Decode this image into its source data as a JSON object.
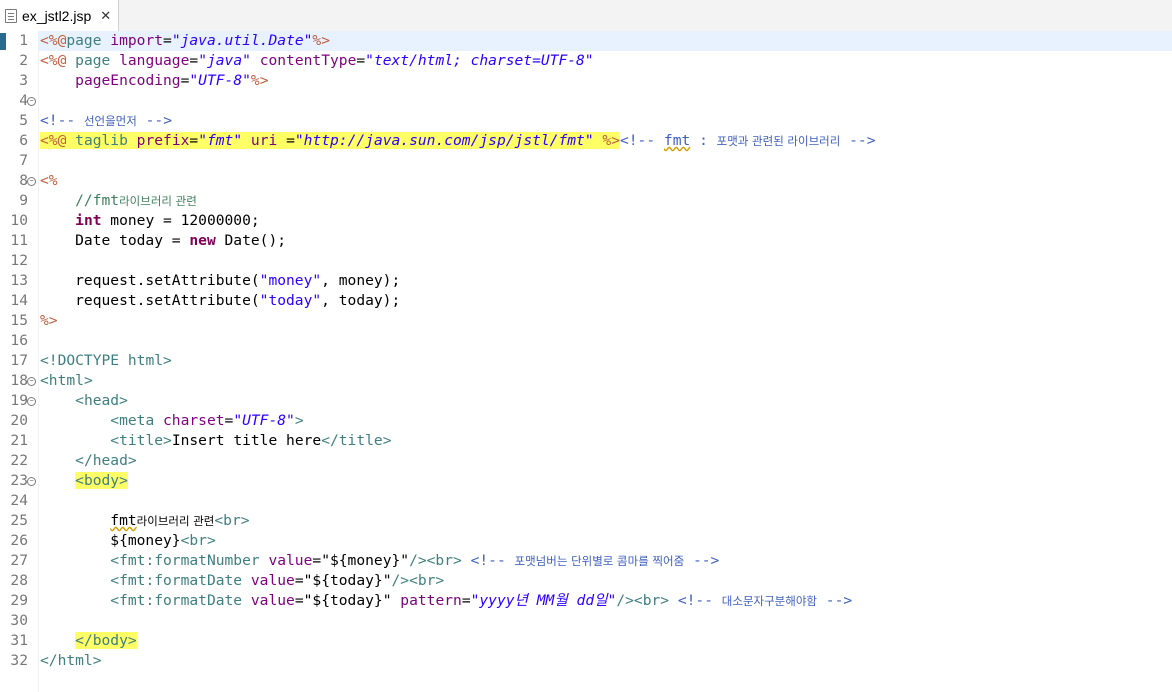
{
  "tab": {
    "title": "ex_jstl2.jsp",
    "close": "✕"
  },
  "lines": [
    {
      "n": "1",
      "cur": true,
      "segs": [
        {
          "t": "<%@",
          "c": "c-dir"
        },
        {
          "t": "page ",
          "c": "c-kw"
        },
        {
          "t": "import",
          "c": "c-attr"
        },
        {
          "t": "=",
          "c": ""
        },
        {
          "t": "\"java.util.Date\"",
          "c": "c-str"
        },
        {
          "t": "%>",
          "c": "c-dir"
        }
      ]
    },
    {
      "n": "2",
      "segs": [
        {
          "t": "<%@ ",
          "c": "c-dir"
        },
        {
          "t": "page ",
          "c": "c-kw"
        },
        {
          "t": "language",
          "c": "c-attr"
        },
        {
          "t": "=",
          "c": ""
        },
        {
          "t": "\"java\"",
          "c": "c-str"
        },
        {
          "t": " ",
          "c": ""
        },
        {
          "t": "contentType",
          "c": "c-attr"
        },
        {
          "t": "=",
          "c": ""
        },
        {
          "t": "\"text/html; charset=UTF-8\"",
          "c": "c-str"
        }
      ]
    },
    {
      "n": "3",
      "segs": [
        {
          "t": "    ",
          "c": ""
        },
        {
          "t": "pageEncoding",
          "c": "c-attr"
        },
        {
          "t": "=",
          "c": ""
        },
        {
          "t": "\"UTF-8\"",
          "c": "c-str"
        },
        {
          "t": "%>",
          "c": "c-dir"
        }
      ]
    },
    {
      "n": "4",
      "fold": true,
      "segs": []
    },
    {
      "n": "5",
      "segs": [
        {
          "t": "<!-- ",
          "c": "c-cm"
        },
        {
          "t": "선언을먼저",
          "c": "c-cm kr"
        },
        {
          "t": " -->",
          "c": "c-cm"
        }
      ]
    },
    {
      "n": "6",
      "segs": [
        {
          "t": "<%@ ",
          "c": "c-dir hl"
        },
        {
          "t": "taglib ",
          "c": "c-kw hl"
        },
        {
          "t": "prefix",
          "c": "c-attr hl"
        },
        {
          "t": "=",
          "c": "hl"
        },
        {
          "t": "\"fmt\"",
          "c": "c-str hl"
        },
        {
          "t": " ",
          "c": "hl"
        },
        {
          "t": "uri ",
          "c": "c-attr hl"
        },
        {
          "t": "=",
          "c": "hl"
        },
        {
          "t": "\"http://java.sun.com/jsp/jstl/fmt\"",
          "c": "c-str hl"
        },
        {
          "t": " ",
          "c": "hl"
        },
        {
          "t": "%>",
          "c": "c-dir hl"
        },
        {
          "t": "<!-- ",
          "c": "c-cm"
        },
        {
          "t": "fmt",
          "c": "c-cm squig"
        },
        {
          "t": " : ",
          "c": "c-cm"
        },
        {
          "t": "포맷과 관련된 라이브러리",
          "c": "c-cm kr"
        },
        {
          "t": " -->",
          "c": "c-cm"
        }
      ]
    },
    {
      "n": "7",
      "segs": []
    },
    {
      "n": "8",
      "fold": true,
      "segs": [
        {
          "t": "<%",
          "c": "c-dir"
        }
      ]
    },
    {
      "n": "9",
      "segs": [
        {
          "t": "    //fmt",
          "c": "c-jcm"
        },
        {
          "t": "라이브러리 관련",
          "c": "c-jcm kr"
        }
      ]
    },
    {
      "n": "10",
      "segs": [
        {
          "t": "    ",
          "c": ""
        },
        {
          "t": "int",
          "c": "c-jkw"
        },
        {
          "t": " money = 12000000;",
          "c": ""
        }
      ]
    },
    {
      "n": "11",
      "segs": [
        {
          "t": "    Date today = ",
          "c": ""
        },
        {
          "t": "new",
          "c": "c-jkw"
        },
        {
          "t": " Date();",
          "c": ""
        }
      ]
    },
    {
      "n": "12",
      "segs": []
    },
    {
      "n": "13",
      "segs": [
        {
          "t": "    request.setAttribute(",
          "c": ""
        },
        {
          "t": "\"money\"",
          "c": "c-jstr"
        },
        {
          "t": ", money);",
          "c": ""
        }
      ]
    },
    {
      "n": "14",
      "segs": [
        {
          "t": "    request.setAttribute(",
          "c": ""
        },
        {
          "t": "\"today\"",
          "c": "c-jstr"
        },
        {
          "t": ", today);",
          "c": ""
        }
      ]
    },
    {
      "n": "15",
      "segs": [
        {
          "t": "%>",
          "c": "c-dir"
        }
      ]
    },
    {
      "n": "16",
      "segs": []
    },
    {
      "n": "17",
      "segs": [
        {
          "t": "<!DOCTYPE ",
          "c": "c-kw"
        },
        {
          "t": "html",
          "c": "c-kw"
        },
        {
          "t": ">",
          "c": "c-kw"
        }
      ]
    },
    {
      "n": "18",
      "fold": true,
      "segs": [
        {
          "t": "<",
          "c": "c-kw"
        },
        {
          "t": "html",
          "c": "c-kw"
        },
        {
          "t": ">",
          "c": "c-kw"
        }
      ]
    },
    {
      "n": "19",
      "fold": true,
      "segs": [
        {
          "t": "    ",
          "c": ""
        },
        {
          "t": "<head>",
          "c": "c-kw"
        }
      ]
    },
    {
      "n": "20",
      "segs": [
        {
          "t": "        ",
          "c": ""
        },
        {
          "t": "<meta ",
          "c": "c-kw"
        },
        {
          "t": "charset",
          "c": "c-attr"
        },
        {
          "t": "=",
          "c": ""
        },
        {
          "t": "\"UTF-8\"",
          "c": "c-str"
        },
        {
          "t": ">",
          "c": "c-kw"
        }
      ]
    },
    {
      "n": "21",
      "segs": [
        {
          "t": "        ",
          "c": ""
        },
        {
          "t": "<title>",
          "c": "c-kw"
        },
        {
          "t": "Insert title here",
          "c": ""
        },
        {
          "t": "</title>",
          "c": "c-kw"
        }
      ]
    },
    {
      "n": "22",
      "segs": [
        {
          "t": "    ",
          "c": ""
        },
        {
          "t": "</head>",
          "c": "c-kw"
        }
      ]
    },
    {
      "n": "23",
      "fold": true,
      "segs": [
        {
          "t": "    ",
          "c": ""
        },
        {
          "t": "<body>",
          "c": "c-kw hl"
        }
      ]
    },
    {
      "n": "24",
      "segs": []
    },
    {
      "n": "25",
      "segs": [
        {
          "t": "        ",
          "c": ""
        },
        {
          "t": "fmt",
          "c": "squig"
        },
        {
          "t": "라이브러리 관련",
          "c": "kr"
        },
        {
          "t": "<br>",
          "c": "c-kw"
        }
      ]
    },
    {
      "n": "26",
      "segs": [
        {
          "t": "        ${money}",
          "c": ""
        },
        {
          "t": "<br>",
          "c": "c-kw"
        }
      ]
    },
    {
      "n": "27",
      "segs": [
        {
          "t": "        ",
          "c": ""
        },
        {
          "t": "<fmt:formatNumber ",
          "c": "c-kw"
        },
        {
          "t": "value",
          "c": "c-attr"
        },
        {
          "t": "=",
          "c": ""
        },
        {
          "t": "\"${money}\"",
          "c": ""
        },
        {
          "t": "/>",
          "c": "c-kw"
        },
        {
          "t": "<br>",
          "c": "c-kw"
        },
        {
          "t": " <!-- ",
          "c": "c-cm"
        },
        {
          "t": "포맷넘버는 단위별로 콤마를 찍어줌",
          "c": "c-cm kr"
        },
        {
          "t": " -->",
          "c": "c-cm"
        }
      ]
    },
    {
      "n": "28",
      "segs": [
        {
          "t": "        ",
          "c": ""
        },
        {
          "t": "<fmt:formatDate ",
          "c": "c-kw"
        },
        {
          "t": "value",
          "c": "c-attr"
        },
        {
          "t": "=",
          "c": ""
        },
        {
          "t": "\"${today}\"",
          "c": ""
        },
        {
          "t": "/>",
          "c": "c-kw"
        },
        {
          "t": "<br>",
          "c": "c-kw"
        }
      ]
    },
    {
      "n": "29",
      "segs": [
        {
          "t": "        ",
          "c": ""
        },
        {
          "t": "<fmt:formatDate ",
          "c": "c-kw"
        },
        {
          "t": "value",
          "c": "c-attr"
        },
        {
          "t": "=",
          "c": ""
        },
        {
          "t": "\"${today}\"",
          "c": ""
        },
        {
          "t": " ",
          "c": ""
        },
        {
          "t": "pattern",
          "c": "c-attr"
        },
        {
          "t": "=",
          "c": ""
        },
        {
          "t": "\"yyyy년 MM월 dd일\"",
          "c": "c-str"
        },
        {
          "t": "/>",
          "c": "c-kw"
        },
        {
          "t": "<br>",
          "c": "c-kw"
        },
        {
          "t": " <!-- ",
          "c": "c-cm"
        },
        {
          "t": "대소문자구분해야함",
          "c": "c-cm kr"
        },
        {
          "t": " -->",
          "c": "c-cm"
        }
      ]
    },
    {
      "n": "30",
      "segs": []
    },
    {
      "n": "31",
      "segs": [
        {
          "t": "    ",
          "c": ""
        },
        {
          "t": "</body>",
          "c": "c-kw hl"
        }
      ]
    },
    {
      "n": "32",
      "segs": [
        {
          "t": "</html>",
          "c": "c-kw"
        }
      ]
    }
  ]
}
